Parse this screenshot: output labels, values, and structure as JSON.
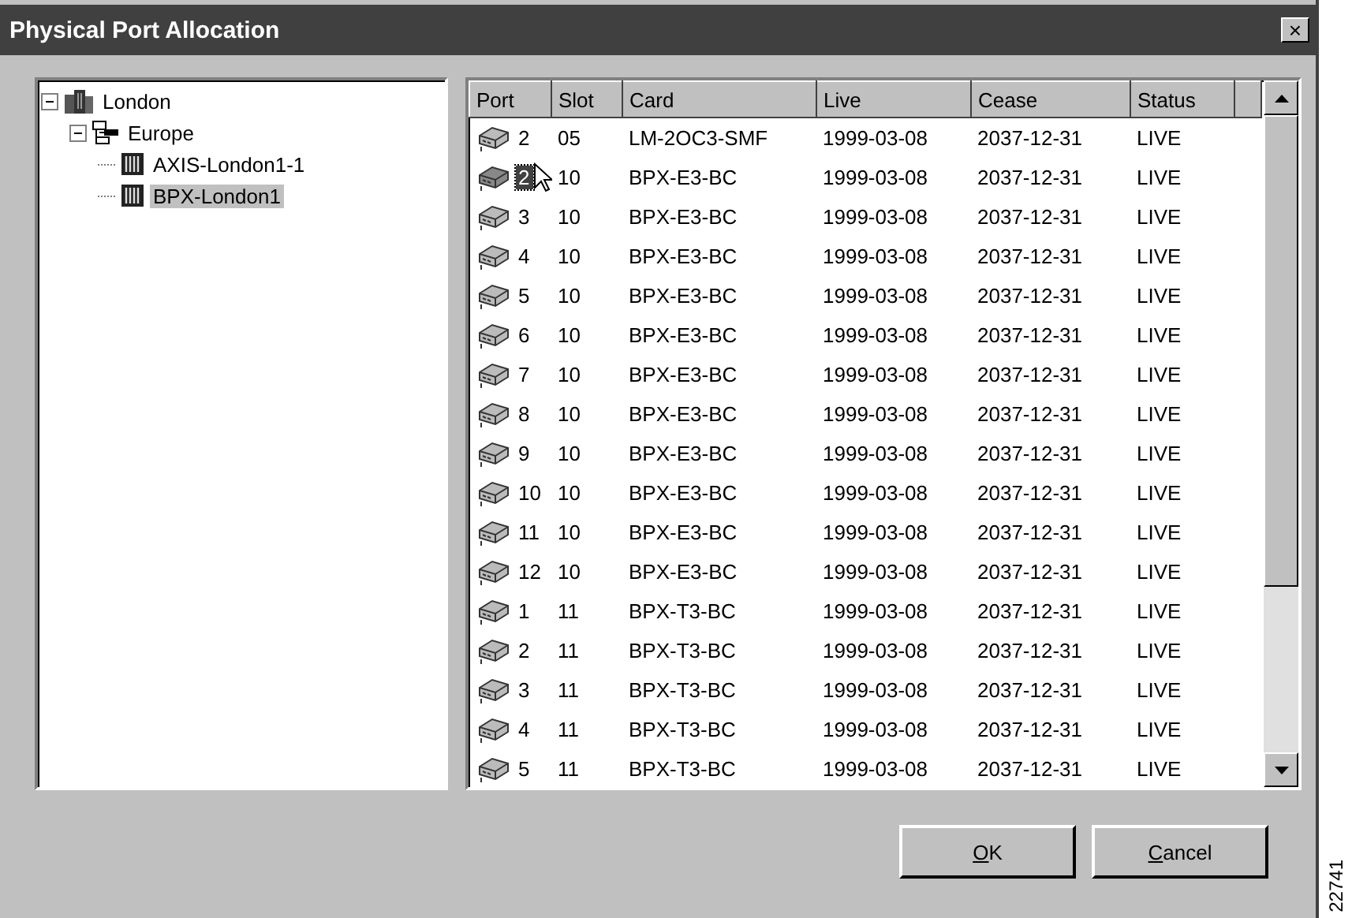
{
  "window": {
    "title": "Physical Port Allocation",
    "close": "×"
  },
  "tree": [
    {
      "label": "London",
      "kind": "site",
      "expanded": true,
      "selected": false,
      "children": [
        {
          "label": "Europe",
          "kind": "network",
          "expanded": true,
          "selected": false,
          "children": [
            {
              "label": "AXIS-London1-1",
              "kind": "node",
              "selected": false
            },
            {
              "label": "BPX-London1",
              "kind": "node",
              "selected": true
            }
          ]
        }
      ]
    }
  ],
  "table": {
    "columns": [
      "Port",
      "Slot",
      "Card",
      "Live",
      "Cease",
      "Status"
    ],
    "rows": [
      {
        "port": "2",
        "slot": "05",
        "card": "LM-2OC3-SMF",
        "live": "1999-03-08",
        "cease": "2037-12-31",
        "status": "LIVE",
        "selected": false
      },
      {
        "port": "2",
        "slot": "10",
        "card": "BPX-E3-BC",
        "live": "1999-03-08",
        "cease": "2037-12-31",
        "status": "LIVE",
        "selected": true
      },
      {
        "port": "3",
        "slot": "10",
        "card": "BPX-E3-BC",
        "live": "1999-03-08",
        "cease": "2037-12-31",
        "status": "LIVE",
        "selected": false
      },
      {
        "port": "4",
        "slot": "10",
        "card": "BPX-E3-BC",
        "live": "1999-03-08",
        "cease": "2037-12-31",
        "status": "LIVE",
        "selected": false
      },
      {
        "port": "5",
        "slot": "10",
        "card": "BPX-E3-BC",
        "live": "1999-03-08",
        "cease": "2037-12-31",
        "status": "LIVE",
        "selected": false
      },
      {
        "port": "6",
        "slot": "10",
        "card": "BPX-E3-BC",
        "live": "1999-03-08",
        "cease": "2037-12-31",
        "status": "LIVE",
        "selected": false
      },
      {
        "port": "7",
        "slot": "10",
        "card": "BPX-E3-BC",
        "live": "1999-03-08",
        "cease": "2037-12-31",
        "status": "LIVE",
        "selected": false
      },
      {
        "port": "8",
        "slot": "10",
        "card": "BPX-E3-BC",
        "live": "1999-03-08",
        "cease": "2037-12-31",
        "status": "LIVE",
        "selected": false
      },
      {
        "port": "9",
        "slot": "10",
        "card": "BPX-E3-BC",
        "live": "1999-03-08",
        "cease": "2037-12-31",
        "status": "LIVE",
        "selected": false
      },
      {
        "port": "10",
        "slot": "10",
        "card": "BPX-E3-BC",
        "live": "1999-03-08",
        "cease": "2037-12-31",
        "status": "LIVE",
        "selected": false
      },
      {
        "port": "11",
        "slot": "10",
        "card": "BPX-E3-BC",
        "live": "1999-03-08",
        "cease": "2037-12-31",
        "status": "LIVE",
        "selected": false
      },
      {
        "port": "12",
        "slot": "10",
        "card": "BPX-E3-BC",
        "live": "1999-03-08",
        "cease": "2037-12-31",
        "status": "LIVE",
        "selected": false
      },
      {
        "port": "1",
        "slot": "11",
        "card": "BPX-T3-BC",
        "live": "1999-03-08",
        "cease": "2037-12-31",
        "status": "LIVE",
        "selected": false
      },
      {
        "port": "2",
        "slot": "11",
        "card": "BPX-T3-BC",
        "live": "1999-03-08",
        "cease": "2037-12-31",
        "status": "LIVE",
        "selected": false
      },
      {
        "port": "3",
        "slot": "11",
        "card": "BPX-T3-BC",
        "live": "1999-03-08",
        "cease": "2037-12-31",
        "status": "LIVE",
        "selected": false
      },
      {
        "port": "4",
        "slot": "11",
        "card": "BPX-T3-BC",
        "live": "1999-03-08",
        "cease": "2037-12-31",
        "status": "LIVE",
        "selected": false
      },
      {
        "port": "5",
        "slot": "11",
        "card": "BPX-T3-BC",
        "live": "1999-03-08",
        "cease": "2037-12-31",
        "status": "LIVE",
        "selected": false
      }
    ]
  },
  "buttons": [
    {
      "label": "OK"
    },
    {
      "label": "Cancel"
    }
  ],
  "figure_number": "22741"
}
